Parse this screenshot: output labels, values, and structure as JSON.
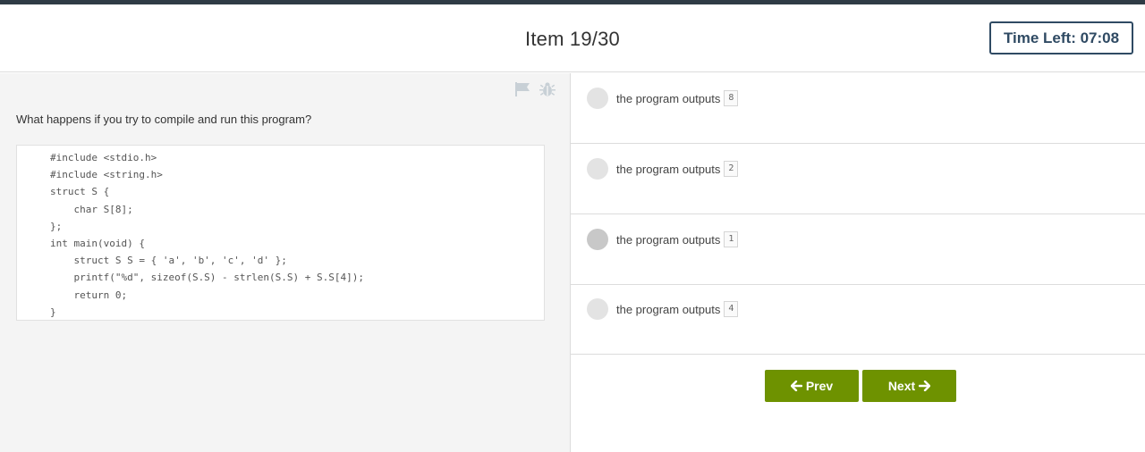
{
  "header": {
    "item_title": "Item 19/30",
    "timer_label": "Time Left: 07:08"
  },
  "question": {
    "text": "What happens if you try to compile and run this program?",
    "code": "#include <stdio.h>\n#include <string.h>\nstruct S {\n    char S[8];\n};\nint main(void) {\n    struct S S = { 'a', 'b', 'c', 'd' };\n    printf(\"%d\", sizeof(S.S) - strlen(S.S) + S.S[4]);\n    return 0;\n}",
    "icons": [
      "flag-icon",
      "bug-icon"
    ]
  },
  "answers": [
    {
      "text": "the program outputs",
      "code": "8"
    },
    {
      "text": "the program outputs",
      "code": "2"
    },
    {
      "text": "the program outputs",
      "code": "1"
    },
    {
      "text": "the program outputs",
      "code": "4"
    }
  ],
  "nav": {
    "prev_label": "Prev",
    "next_label": "Next",
    "prev_icon": "arrow-left-icon",
    "next_icon": "arrow-right-icon"
  },
  "colors": {
    "accent_green": "#6e9200",
    "timer_blue": "#2f4a63",
    "top_bar": "#2f3b45",
    "panel_gray": "#f4f4f4"
  }
}
